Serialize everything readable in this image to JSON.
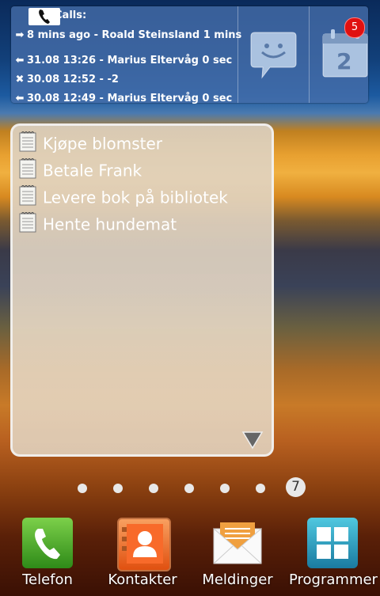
{
  "calls_widget": {
    "title": "Calls:",
    "badge_count": "5",
    "calendar_day": "2",
    "calls": [
      {
        "icon": "outgoing-arrow-icon",
        "arrow": "➡",
        "text": "8 mins ago - Roald Steinsland 1 mins"
      },
      {
        "icon": "incoming-arrow-icon",
        "arrow": "⬅",
        "text": "31.08 13:26 - Marius Eltervåg 0 sec"
      },
      {
        "icon": "missed-call-icon",
        "arrow": "✖",
        "text": "30.08 12:52 - -2"
      },
      {
        "icon": "incoming-arrow-icon",
        "arrow": "⬅",
        "text": "30.08 12:49 - Marius Eltervåg 0 sec"
      }
    ]
  },
  "notes": {
    "items": [
      "Kjøpe blomster",
      "Betale Frank",
      "Levere bok på bibliotek",
      "Hente hundemat"
    ]
  },
  "pager": {
    "current_page": "7",
    "total_dots": 7
  },
  "dock": [
    {
      "label": "Telefon",
      "icon": "phone-icon"
    },
    {
      "label": "Kontakter",
      "icon": "contacts-icon"
    },
    {
      "label": "Meldinger",
      "icon": "messages-icon"
    },
    {
      "label": "Programmer",
      "icon": "apps-grid-icon"
    }
  ]
}
